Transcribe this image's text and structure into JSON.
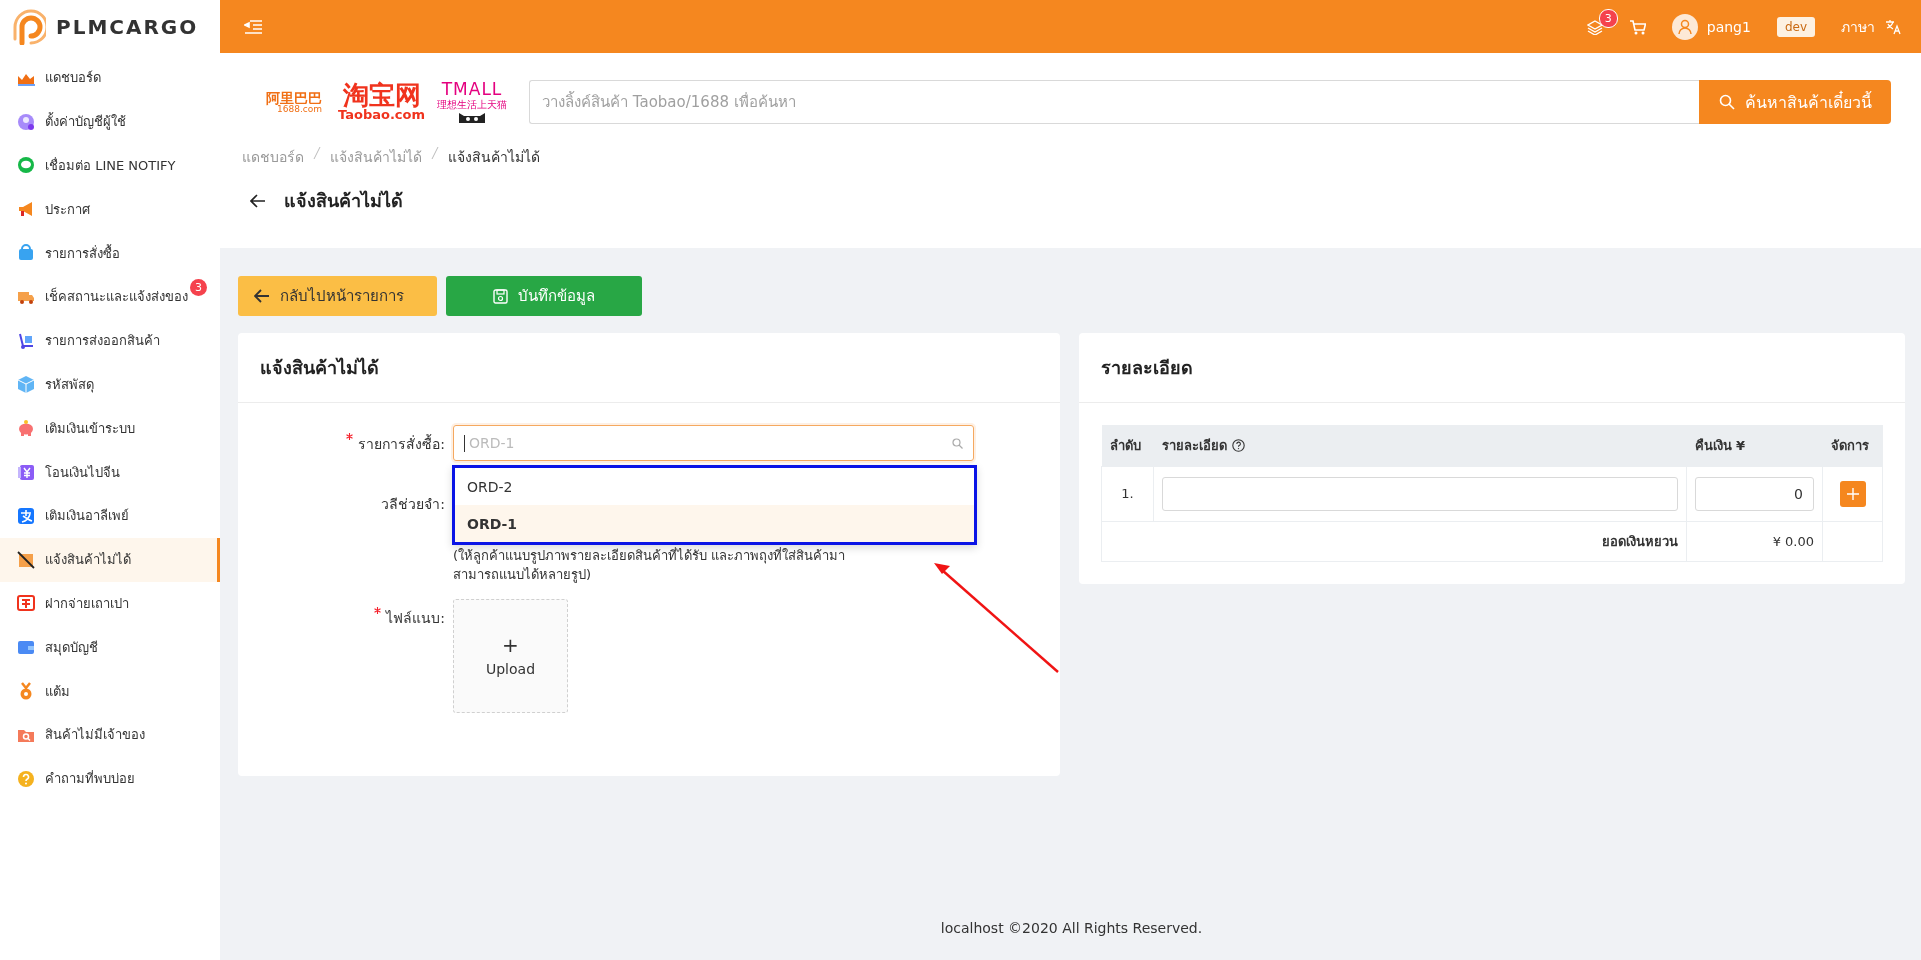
{
  "brand": {
    "name": "PLMCARGO"
  },
  "sidebar": {
    "items": [
      {
        "label": "แดชบอร์ด",
        "selected": false
      },
      {
        "label": "ตั้งค่าบัญชีผู้ใช้",
        "selected": false
      },
      {
        "label": "เชื่อมต่อ LINE NOTIFY",
        "selected": false
      },
      {
        "label": "ประกาศ",
        "selected": false
      },
      {
        "label": "รายการสั่งซื้อ",
        "selected": false
      },
      {
        "label": "เช็คสถานะและแจ้งส่งของ",
        "selected": false,
        "badge": "3"
      },
      {
        "label": "รายการส่งออกสินค้า",
        "selected": false
      },
      {
        "label": "รหัสพัสดุ",
        "selected": false
      },
      {
        "label": "เติมเงินเข้าระบบ",
        "selected": false
      },
      {
        "label": "โอนเงินไปจีน",
        "selected": false
      },
      {
        "label": "เติมเงินอาลีเพย์",
        "selected": false
      },
      {
        "label": "แจ้งสินค้าไม่ได้",
        "selected": true
      },
      {
        "label": "ฝากจ่ายเถาเปา",
        "selected": false
      },
      {
        "label": "สมุดบัญชี",
        "selected": false
      },
      {
        "label": "แต้ม",
        "selected": false
      },
      {
        "label": "สินค้าไม่มีเจ้าของ",
        "selected": false
      },
      {
        "label": "คำถามที่พบบ่อย",
        "selected": false
      }
    ]
  },
  "topbar": {
    "notifications": "3",
    "user": "pang1",
    "env": "dev",
    "language": "ภาษา"
  },
  "logos": {
    "alibaba": {
      "cn": "阿里巴巴",
      "site": "1688.com"
    },
    "taobao": {
      "cn": "淘宝网",
      "site": "Taobao.com"
    },
    "tmall": {
      "name": "TMALL",
      "slogan": "理想生活上天猫"
    }
  },
  "search": {
    "placeholder": "วางลิ้งค์สินค้า Taobao/1688 เพื่อค้นหา",
    "button": "ค้นหาสินค้าเดี๋ยวนี้"
  },
  "breadcrumb": [
    "แดชบอร์ด",
    "แจ้งสินค้าไม่ได้",
    "แจ้งสินค้าไม่ได้"
  ],
  "page_title": "แจ้งสินค้าไม่ได้",
  "actions": {
    "back": "กลับไปหน้ารายการ",
    "save": "บันทึกข้อมูล"
  },
  "form": {
    "title": "แจ้งสินค้าไม่ได้",
    "order": {
      "label": "รายการสั่งซื้อ:",
      "required": true,
      "placeholder": "ORD-1"
    },
    "options": [
      {
        "label": "ORD-2",
        "selected": false
      },
      {
        "label": "ORD-1",
        "selected": true
      }
    ],
    "phrase": {
      "label": "วลีช่วยจำ:",
      "required": false
    },
    "hint": "(ให้ลูกค้าแนบรูปภาพรายละเอียดสินค้าที่ได้รับ และภาพถุงที่ใส่สินค้ามาสามารถแนบได้หลายรูป)",
    "attachment": {
      "label": "ไฟล์แนบ:",
      "required": true,
      "plus": "+",
      "upload": "Upload"
    }
  },
  "details": {
    "title": "รายละเอียด",
    "columns": [
      "ลำดับ",
      "รายละเอียด",
      "คืนเงิน ¥",
      "จัดการ"
    ],
    "rows": [
      {
        "index": "1.",
        "amount": "0"
      }
    ],
    "total_label": "ยอดเงินหยวน",
    "total": "¥ 0.00"
  },
  "footer": "localhost ©2020 All Rights Reserved."
}
